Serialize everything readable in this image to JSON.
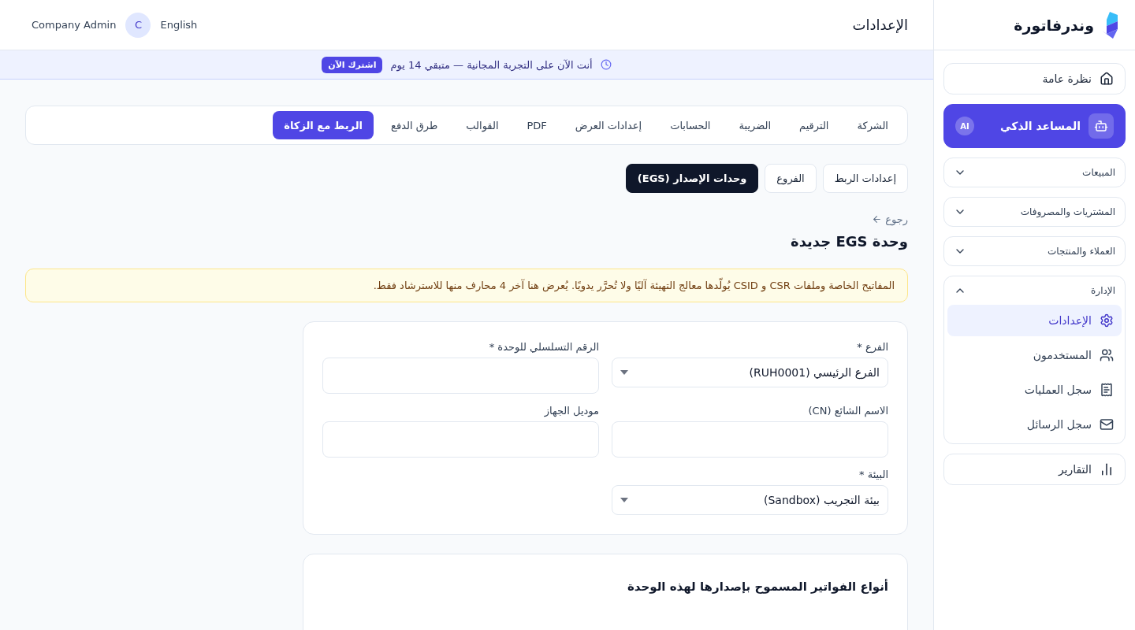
{
  "sidebar": {
    "brand": "وندرفاتورة",
    "items": [
      {
        "kind": "link",
        "label": "نظرة عامة",
        "selected": false
      },
      {
        "kind": "link",
        "label": "المساعد الذكي",
        "selected": true,
        "badge": "AI"
      },
      {
        "kind": "section",
        "label": "المبيعات",
        "expanded": false
      },
      {
        "kind": "section",
        "label": "المشتريات والمصروفات",
        "expanded": false
      },
      {
        "kind": "section",
        "label": "العملاء والمنتجات",
        "expanded": false
      },
      {
        "kind": "section",
        "label": "الإدارة",
        "expanded": true,
        "children": [
          {
            "label": "الإعدادات",
            "selected": true
          },
          {
            "label": "المستخدمون",
            "selected": false
          },
          {
            "label": "سجل العمليات",
            "selected": false
          },
          {
            "label": "سجل الرسائل",
            "selected": false
          }
        ]
      },
      {
        "kind": "link",
        "label": "التقارير",
        "selected": false
      }
    ]
  },
  "header": {
    "title": "الإعدادات",
    "language": "English",
    "avatar": "C",
    "user": "Company Admin"
  },
  "trial_banner": {
    "text": "أنت الآن على التجربة المجانية — متبقي 14 يوم",
    "button": "اشترك الآن"
  },
  "tabs": [
    {
      "label": "الشركة",
      "selected": false
    },
    {
      "label": "الترقيم",
      "selected": false
    },
    {
      "label": "الضريبة",
      "selected": false
    },
    {
      "label": "الحسابات",
      "selected": false
    },
    {
      "label": "إعدادات العرض",
      "selected": false
    },
    {
      "label": "PDF",
      "selected": false
    },
    {
      "label": "القوالب",
      "selected": false
    },
    {
      "label": "طرق الدفع",
      "selected": false
    },
    {
      "label": "الربط مع الزكاة",
      "selected": true
    }
  ],
  "subtabs": [
    {
      "label": "إعدادات الربط",
      "selected": false
    },
    {
      "label": "الفروع",
      "selected": false
    },
    {
      "label": "وحدات الإصدار (EGS)",
      "selected": true
    }
  ],
  "back_link": "رجوع",
  "page_title": "وحدة EGS جديدة",
  "notice": "المفاتيح الخاصة وملفات CSR و CSID يُولّدها معالج التهيئة آليًا ولا تُحرَّر يدويًا. يُعرض هنا آخر 4 محارف منها للاسترشاد فقط.",
  "form": {
    "fields": [
      {
        "kind": "select",
        "label": "الفرع *",
        "value": "الفرع الرئيسي (RUH0001)"
      },
      {
        "kind": "input",
        "label": "الرقم التسلسلي للوحدة *"
      },
      {
        "kind": "input",
        "label": "الاسم الشائع (CN)"
      },
      {
        "kind": "input",
        "label": "موديل الجهاز"
      },
      {
        "kind": "select",
        "label": "البيئة *",
        "value": "بيئة التجريب (Sandbox)"
      }
    ]
  },
  "invoice_types_card": {
    "title": "أنواع الفواتير المسموح بإصدارها لهذه الوحدة"
  }
}
